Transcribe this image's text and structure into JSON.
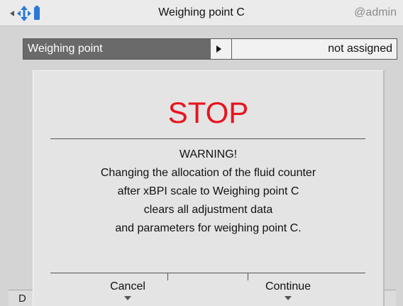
{
  "header": {
    "title": "Weighing point C",
    "user": "@admin",
    "nav_icon": "nav-arrows-battery-icon"
  },
  "param": {
    "label": "Weighing point",
    "value": "not assigned"
  },
  "dialog": {
    "title": "STOP",
    "title_color": "#e8141e",
    "lines": [
      "WARNING!",
      "Changing the allocation of the fluid counter",
      "after xBPI scale to Weighing point C",
      "clears all adjustment data",
      "and parameters for weighing point C."
    ],
    "buttons": {
      "cancel": "Cancel",
      "continue": "Continue"
    }
  },
  "footer": {
    "left_text": "D"
  }
}
